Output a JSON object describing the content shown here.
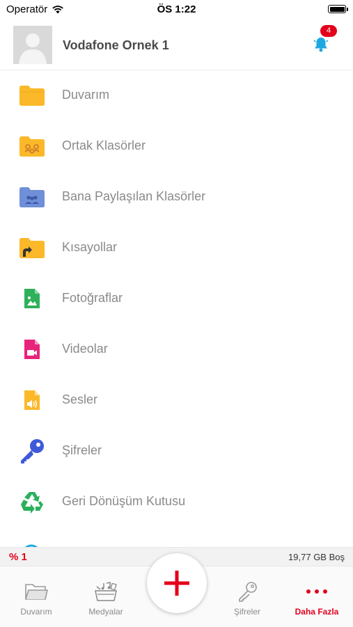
{
  "status_bar": {
    "carrier": "Operatör",
    "time": "ÖS 1:22"
  },
  "header": {
    "user_name": "Vodafone Ornek 1",
    "notification_count": "4"
  },
  "menu": {
    "items": [
      {
        "label": "Duvarım",
        "icon": "folder-icon"
      },
      {
        "label": "Ortak Klasörler",
        "icon": "shared-folder-icon"
      },
      {
        "label": "Bana Paylaşılan Klasörler",
        "icon": "shared-with-me-folder-icon"
      },
      {
        "label": "Kısayollar",
        "icon": "shortcut-folder-icon"
      },
      {
        "label": "Fotoğraflar",
        "icon": "photo-file-icon"
      },
      {
        "label": "Videolar",
        "icon": "video-file-icon"
      },
      {
        "label": "Sesler",
        "icon": "audio-file-icon"
      },
      {
        "label": "Şifreler",
        "icon": "key-icon"
      },
      {
        "label": "Geri Dönüşüm Kutusu",
        "icon": "recycle-icon"
      }
    ]
  },
  "storage": {
    "percent_label": "% 1",
    "free_label": "19,77 GB Boş"
  },
  "tab_bar": {
    "tabs": [
      {
        "label": "Duvarım",
        "icon": "folder-outline-icon"
      },
      {
        "label": "Medyalar",
        "icon": "media-icon"
      },
      {
        "label": "Şifreler",
        "icon": "key-outline-icon"
      },
      {
        "label": "Daha Fazla",
        "icon": "more-dots-icon"
      }
    ],
    "active_tab": "Daha Fazla"
  },
  "colors": {
    "brand_red": "#e4001c",
    "folder_yellow": "#fbb829",
    "folder_blue": "#6f8fd8",
    "photo_green": "#2fb05a",
    "video_pink": "#e8237a",
    "key_blue": "#3f5ad8",
    "recycle_green": "#29b05a",
    "bell_blue": "#1ea8e0"
  }
}
